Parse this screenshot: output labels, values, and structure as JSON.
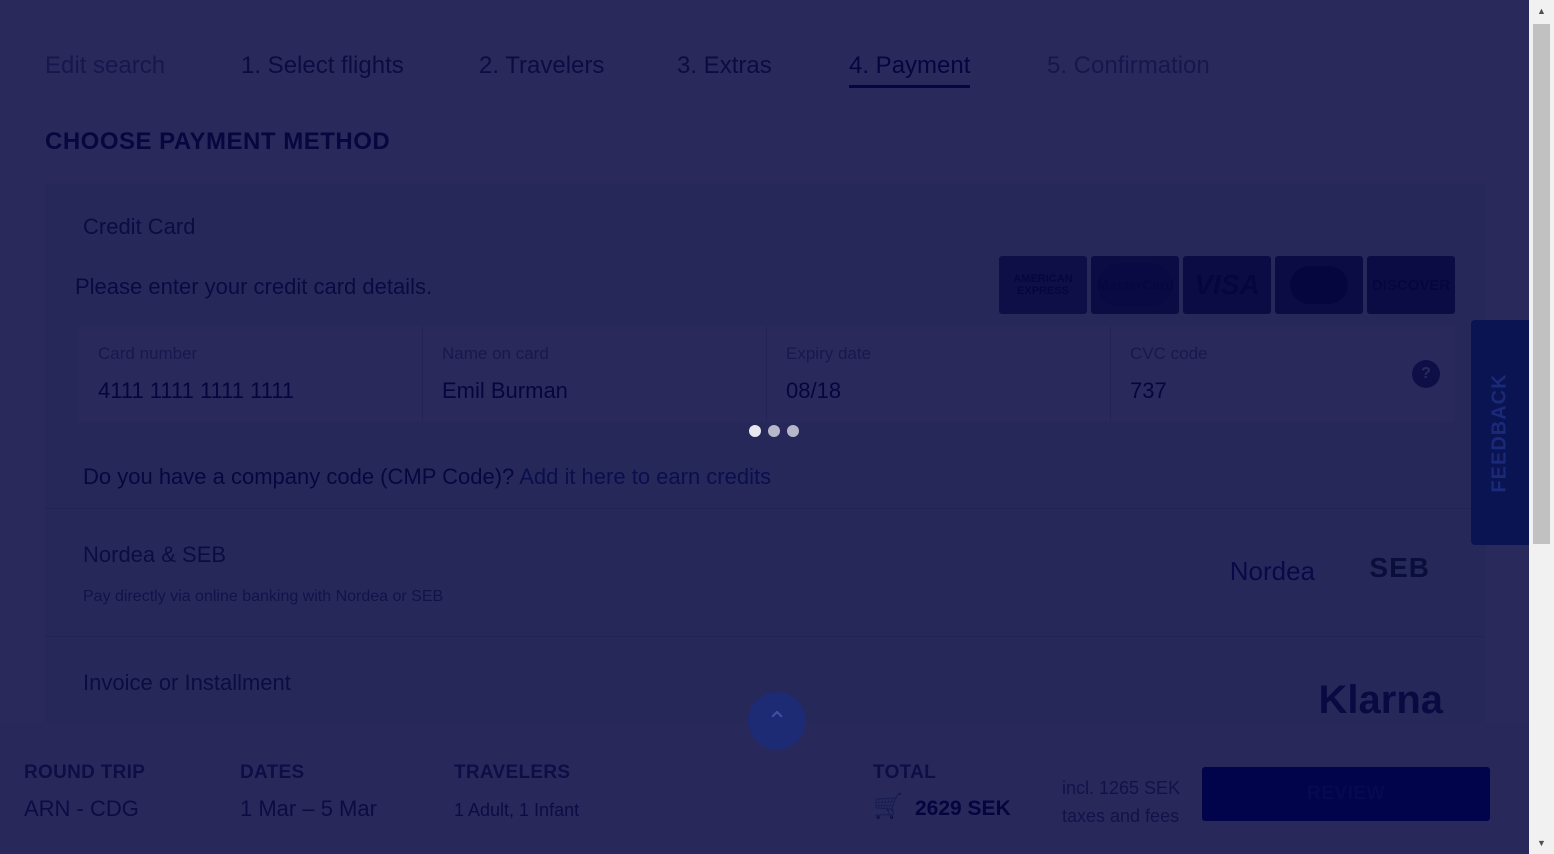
{
  "nav": {
    "edit_search": "Edit search",
    "steps": [
      "1. Select flights",
      "2. Travelers",
      "3. Extras",
      "4. Payment",
      "5. Confirmation"
    ],
    "close": "×"
  },
  "payment": {
    "title": "CHOOSE PAYMENT METHOD",
    "credit_card": {
      "title": "Credit Card",
      "description": "Please enter your credit card details.",
      "cards": [
        "AMERICAN EXPRESS",
        "MasterCard",
        "VISA",
        "Diners Club",
        "DISCOVER"
      ],
      "fields": {
        "card_number_label": "Card number",
        "card_number_value": "4111 1111 1111 1111",
        "name_label": "Name on card",
        "name_value": "Emil Burman",
        "expiry_label": "Expiry date",
        "expiry_value": "08/18",
        "cvc_label": "CVC code",
        "cvc_value": "737",
        "help": "?"
      }
    },
    "company_code": {
      "text": "Do you have a company code (CMP Code)?",
      "link": "Add it here to earn credits"
    },
    "nordea_seb": {
      "title": "Nordea & SEB",
      "subtitle": "Pay directly via online banking with Nordea or SEB",
      "logo_nordea": "Nordea",
      "logo_seb": "SEB"
    },
    "invoice": {
      "title": "Invoice or Installment",
      "logo": "Klarna"
    }
  },
  "feedback": "FEEDBACK",
  "footer": {
    "trip_label": "ROUND TRIP",
    "trip_value": "ARN - CDG",
    "dates_label": "DATES",
    "dates_value": "1 Mar – 5 Mar",
    "travelers_label": "TRAVELERS",
    "travelers_value": "1 Adult, 1 Infant",
    "total_label": "TOTAL",
    "total_value": "2629 SEK",
    "note": "incl. 1265 SEK taxes and fees",
    "review_button": "REVIEW"
  }
}
